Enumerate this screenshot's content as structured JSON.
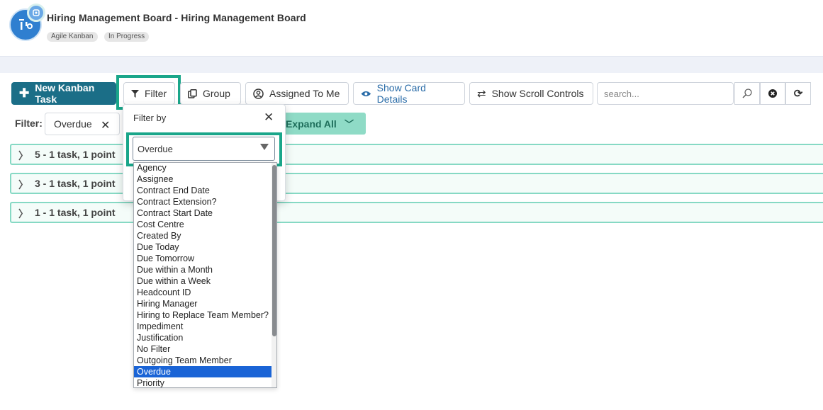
{
  "header": {
    "title": "Hiring Management Board - Hiring Management Board",
    "tags": [
      "Agile Kanban",
      "In Progress"
    ],
    "logo_icon": "board-icon",
    "badge_icon": "notification-icon"
  },
  "toolbar": {
    "new_task": "New Kanban Task",
    "filter": "Filter",
    "group": "Group",
    "assigned": "Assigned To Me",
    "show_card_details": "Show Card Details",
    "show_scroll_controls": "Show Scroll Controls",
    "search_placeholder": "search...",
    "accent_color": "#1b6e87",
    "highlight_color": "#1aa68a"
  },
  "filter_row": {
    "label": "Filter:",
    "chip": "Overdue",
    "expand_all": "Expand All"
  },
  "groups": [
    {
      "label": "5  -  1 task, 1 point"
    },
    {
      "label": "3  -  1 task, 1 point"
    },
    {
      "label": "1  -  1 task, 1 point"
    }
  ],
  "popover": {
    "title": "Filter by",
    "selected": "Overdue"
  },
  "dropdown": {
    "items": [
      "Agency",
      "Assignee",
      "Contract End Date",
      "Contract Extension?",
      "Contract Start Date",
      "Cost Centre",
      "Created By",
      "Due Today",
      "Due Tomorrow",
      "Due within a Month",
      "Due within a Week",
      "Headcount ID",
      "Hiring Manager",
      "Hiring to Replace Team Member?",
      "Impediment",
      "Justification",
      "No Filter",
      "Outgoing Team Member",
      "Overdue",
      "Priority"
    ],
    "selected_index": 18
  }
}
